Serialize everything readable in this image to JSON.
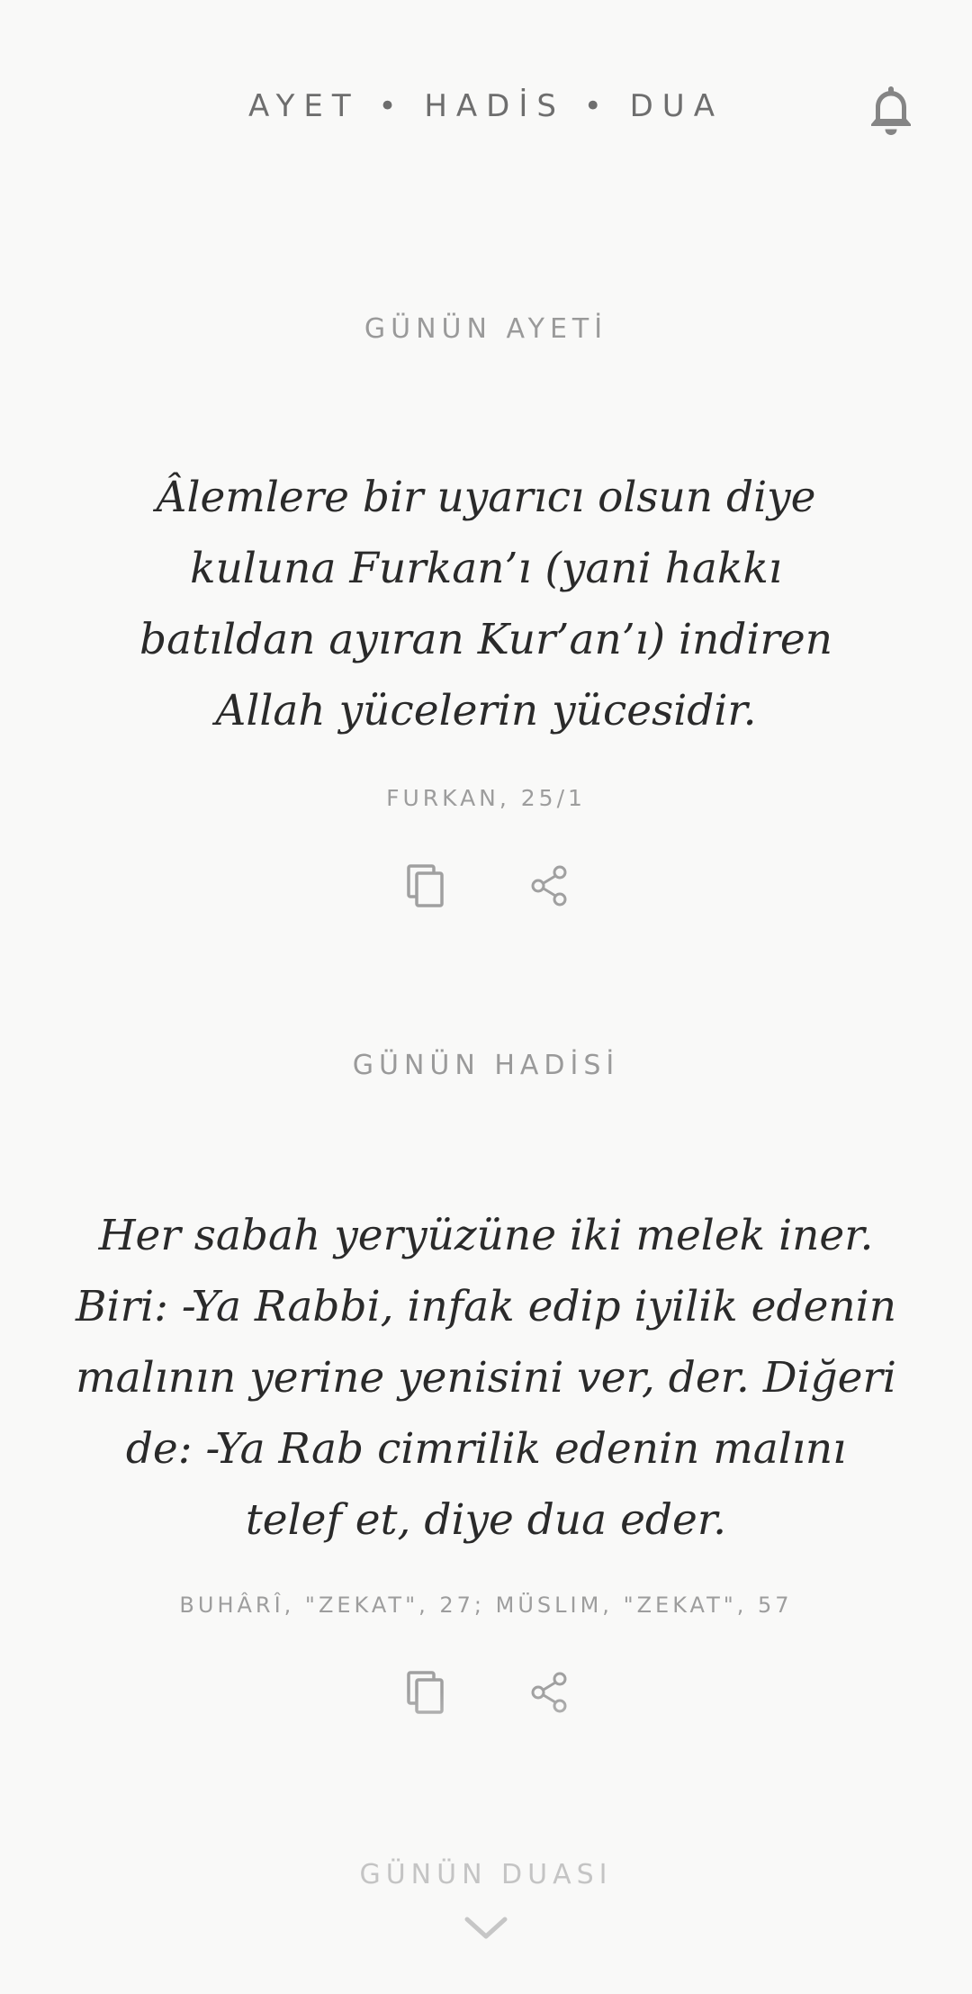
{
  "header": {
    "title": "AYET • HADİS • DUA",
    "bell_icon": "bell-icon"
  },
  "ayet": {
    "section_title": "GÜNÜN AYETİ",
    "text": "Âlemlere bir uyarıcı olsun diye kuluna Furkan’ı (yani hakkı batıldan ayıran Kur’an’ı) indiren Allah yücelerin yücesidir.",
    "source": "FURKAN, 25/1",
    "copy_icon": "copy-icon",
    "share_icon": "share-icon"
  },
  "hadis": {
    "section_title": "GÜNÜN HADİSİ",
    "text": "Her sabah yeryüzüne iki melek iner. Biri: -Ya Rabbi, infak edip iyilik edenin malının yerine yenisini ver, der. Diğeri de: -Ya Rab cimrilik edenin malını telef et, diye dua eder.",
    "source": "BUHÂRÎ, \"ZEKAT\", 27; MÜSLIM, \"ZEKAT\", 57",
    "copy_icon": "copy-icon",
    "share_icon": "share-icon"
  },
  "dua": {
    "section_title": "GÜNÜN DUASI",
    "expand_icon": "chevron-down-icon"
  },
  "colors": {
    "background": "#f9f9f8",
    "text": "#2a2a2a",
    "muted": "#9a9a9a",
    "icon": "#8a8a8a"
  }
}
